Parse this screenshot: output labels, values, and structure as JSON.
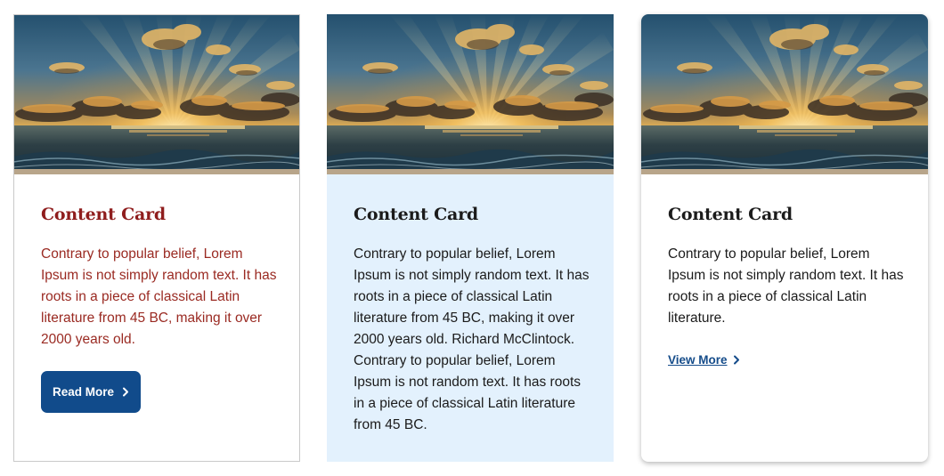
{
  "cards": [
    {
      "title": "Content Card",
      "text": "Contrary to popular belief, Lorem Ipsum is not simply random text. It has roots in a piece of classical Latin literature from 45 BC, making it over 2000 years old.",
      "button_label": "Read More",
      "image": "sunset-over-ocean"
    },
    {
      "title": "Content Card",
      "text": "Contrary to popular belief, Lorem Ipsum is not simply random text. It has roots in a piece of classical Latin literature from 45 BC, making it over 2000 years old. Richard McClintock. Contrary to popular belief, Lorem Ipsum is not random text. It has roots in a piece of classical Latin literature from 45 BC.",
      "image": "sunset-over-ocean"
    },
    {
      "title": "Content Card",
      "text": "Contrary to popular belief, Lorem Ipsum is not simply random text. It has roots in a piece of classical Latin literature.",
      "link_label": "View More",
      "image": "sunset-over-ocean"
    }
  ],
  "icons": {
    "button_chevron": "chevron-right-icon",
    "link_chevron": "chevron-right-icon"
  },
  "colors": {
    "accent_red": "#8f1d1d",
    "button_blue": "#114b8b",
    "link_blue": "#154c8a",
    "highlight_bg": "#e3f1fd"
  }
}
